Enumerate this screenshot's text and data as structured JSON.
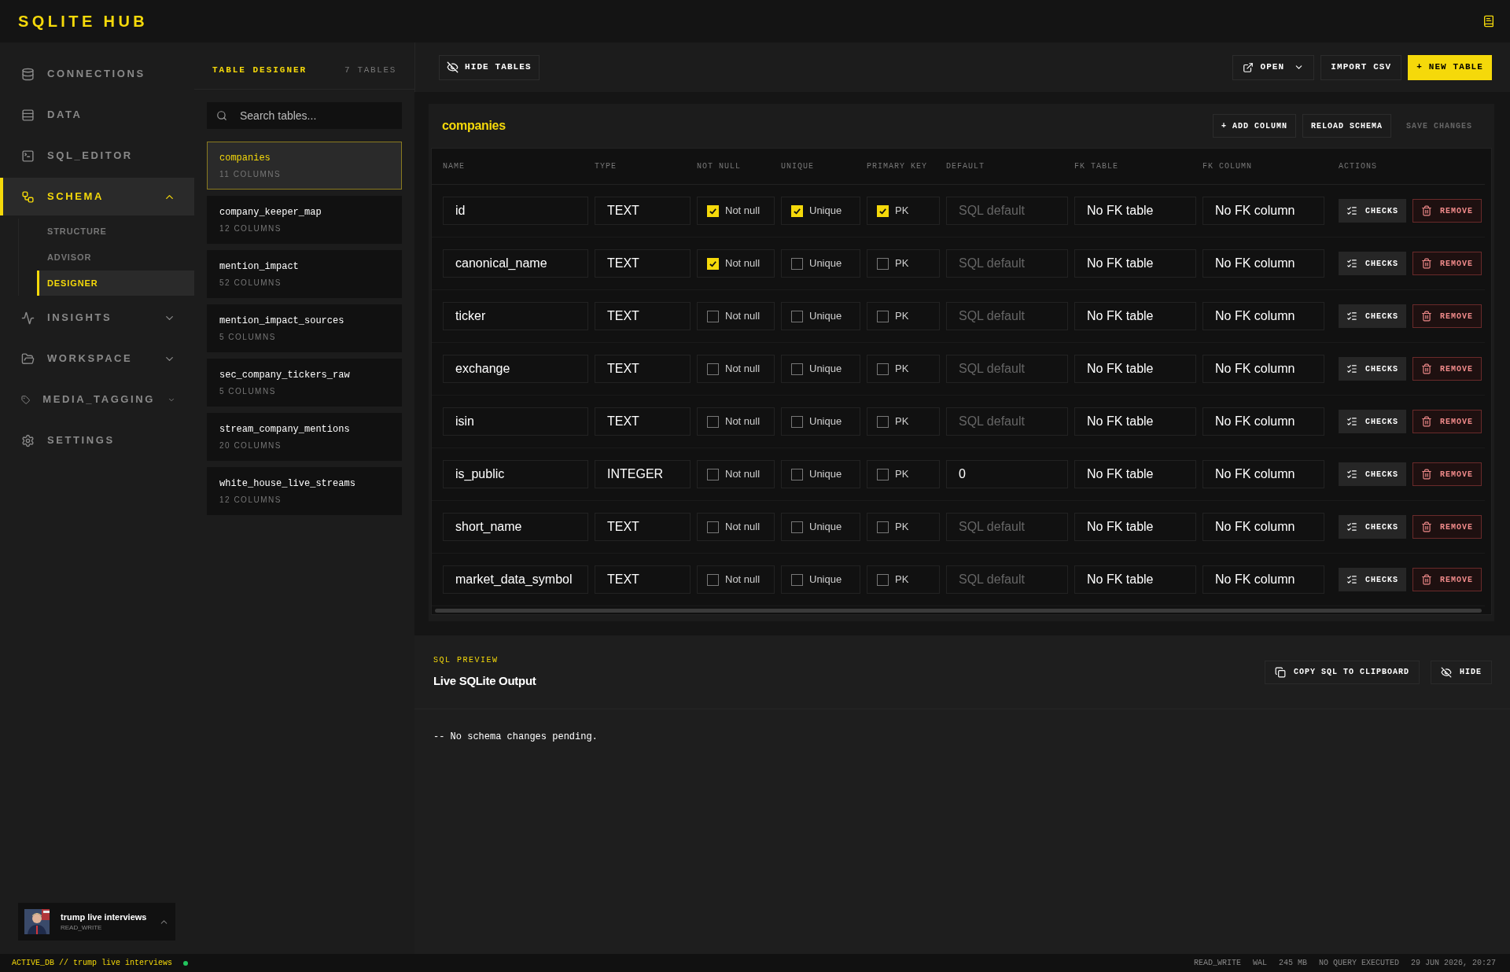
{
  "app": {
    "title": "SQLITE HUB"
  },
  "nav": [
    {
      "label": "CONNECTIONS",
      "selected": false
    },
    {
      "label": "DATA",
      "selected": false
    },
    {
      "label": "SQL_EDITOR",
      "selected": false
    },
    {
      "label": "SCHEMA",
      "selected": true,
      "expanded": true,
      "children": [
        {
          "label": "STRUCTURE",
          "selected": false
        },
        {
          "label": "ADVISOR",
          "selected": false
        },
        {
          "label": "DESIGNER",
          "selected": true
        }
      ]
    },
    {
      "label": "INSIGHTS",
      "selected": false,
      "expanded": false
    },
    {
      "label": "WORKSPACE",
      "selected": false,
      "expanded": false
    },
    {
      "label": "MEDIA_TAGGING",
      "selected": false,
      "expanded": false
    },
    {
      "label": "SETTINGS",
      "selected": false
    }
  ],
  "account": {
    "name": "trump live interviews",
    "role": "READ_WRITE",
    "expanded": false
  },
  "table_list": {
    "title": "TABLE DESIGNER",
    "count": "7 TABLES",
    "search": {
      "placeholder": "Search tables..."
    },
    "tables": [
      {
        "name": "companies",
        "columns": "11 COLUMNS",
        "selected": true
      },
      {
        "name": "company_keeper_map",
        "columns": "12 COLUMNS",
        "selected": false
      },
      {
        "name": "mention_impact",
        "columns": "52 COLUMNS",
        "selected": false
      },
      {
        "name": "mention_impact_sources",
        "columns": "5 COLUMNS",
        "selected": false
      },
      {
        "name": "sec_company_tickers_raw",
        "columns": "5 COLUMNS",
        "selected": false
      },
      {
        "name": "stream_company_mentions",
        "columns": "20 COLUMNS",
        "selected": false
      },
      {
        "name": "white_house_live_streams",
        "columns": "12 COLUMNS",
        "selected": false
      }
    ]
  },
  "toolbar": {
    "hide_tables": "HIDE TABLES",
    "open": "OPEN",
    "import": "IMPORT CSV",
    "new_table": "+ NEW TABLE"
  },
  "designer": {
    "title": "companies",
    "actions": [
      {
        "label": "+ ADD COLUMN",
        "disabled": false
      },
      {
        "label": "RELOAD SCHEMA",
        "disabled": false
      },
      {
        "label": "SAVE CHANGES",
        "disabled": true
      }
    ],
    "columns": [
      "NAME",
      "TYPE",
      "NOT NULL",
      "UNIQUE",
      "PRIMARY KEY",
      "DEFAULT",
      "FK TABLE",
      "FK COLUMN",
      "ACTIONS"
    ],
    "rows": [
      {
        "name": "id",
        "type": "TEXT",
        "not_null": {
          "label": "Not null",
          "checked": true
        },
        "unique": {
          "label": "Unique",
          "checked": true
        },
        "pk": {
          "label": "PK",
          "checked": true
        },
        "default": {
          "placeholder": "SQL default"
        },
        "fk_table": "No FK table",
        "fk_column": "No FK column",
        "checks": "CHECKS",
        "remove": "REMOVE"
      },
      {
        "name": "canonical_name",
        "type": "TEXT",
        "not_null": {
          "label": "Not null",
          "checked": true
        },
        "unique": {
          "label": "Unique",
          "checked": false
        },
        "pk": {
          "label": "PK",
          "checked": false
        },
        "default": {
          "placeholder": "SQL default"
        },
        "fk_table": "No FK table",
        "fk_column": "No FK column",
        "checks": "CHECKS",
        "remove": "REMOVE"
      },
      {
        "name": "ticker",
        "type": "TEXT",
        "not_null": {
          "label": "Not null",
          "checked": false
        },
        "unique": {
          "label": "Unique",
          "checked": false
        },
        "pk": {
          "label": "PK",
          "checked": false
        },
        "default": {
          "placeholder": "SQL default"
        },
        "fk_table": "No FK table",
        "fk_column": "No FK column",
        "checks": "CHECKS",
        "remove": "REMOVE"
      },
      {
        "name": "exchange",
        "type": "TEXT",
        "not_null": {
          "label": "Not null",
          "checked": false
        },
        "unique": {
          "label": "Unique",
          "checked": false
        },
        "pk": {
          "label": "PK",
          "checked": false
        },
        "default": {
          "placeholder": "SQL default"
        },
        "fk_table": "No FK table",
        "fk_column": "No FK column",
        "checks": "CHECKS",
        "remove": "REMOVE"
      },
      {
        "name": "isin",
        "type": "TEXT",
        "not_null": {
          "label": "Not null",
          "checked": false
        },
        "unique": {
          "label": "Unique",
          "checked": false
        },
        "pk": {
          "label": "PK",
          "checked": false
        },
        "default": {
          "placeholder": "SQL default"
        },
        "fk_table": "No FK table",
        "fk_column": "No FK column",
        "checks": "CHECKS",
        "remove": "REMOVE"
      },
      {
        "name": "is_public",
        "type": "INTEGER",
        "not_null": {
          "label": "Not null",
          "checked": false
        },
        "unique": {
          "label": "Unique",
          "checked": false
        },
        "pk": {
          "label": "PK",
          "checked": false
        },
        "default": {
          "value": "0"
        },
        "fk_table": "No FK table",
        "fk_column": "No FK column",
        "checks": "CHECKS",
        "remove": "REMOVE"
      },
      {
        "name": "short_name",
        "type": "TEXT",
        "not_null": {
          "label": "Not null",
          "checked": false
        },
        "unique": {
          "label": "Unique",
          "checked": false
        },
        "pk": {
          "label": "PK",
          "checked": false
        },
        "default": {
          "placeholder": "SQL default"
        },
        "fk_table": "No FK table",
        "fk_column": "No FK column",
        "checks": "CHECKS",
        "remove": "REMOVE"
      },
      {
        "name": "market_data_symbol",
        "type": "TEXT",
        "not_null": {
          "label": "Not null",
          "checked": false
        },
        "unique": {
          "label": "Unique",
          "checked": false
        },
        "pk": {
          "label": "PK",
          "checked": false
        },
        "default": {
          "placeholder": "SQL default"
        },
        "fk_table": "No FK table",
        "fk_column": "No FK column",
        "checks": "CHECKS",
        "remove": "REMOVE"
      }
    ]
  },
  "sql_preview": {
    "label": "SQL PREVIEW",
    "title": "Live SQLite Output",
    "copy": "COPY SQL TO CLIPBOARD",
    "hide": "HIDE",
    "code": "-- No schema changes pending."
  },
  "status_bar": {
    "active": "ACTIVE_DB // trump live interviews",
    "connected": true,
    "items": [
      "READ_WRITE",
      "WAL",
      "245 MB",
      "NO QUERY EXECUTED",
      "29 JUN 2026, 20:27"
    ]
  }
}
